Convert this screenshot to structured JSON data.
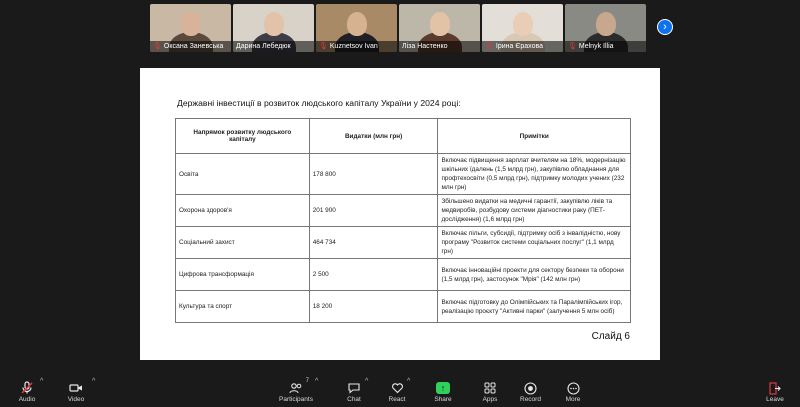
{
  "participants": [
    {
      "name": "Оксана Заневська",
      "muted": true,
      "bg": "#c9b9a4",
      "skin": "#d8b39a",
      "shirt": "#5b4a3c"
    },
    {
      "name": "Дарина Лебедюк",
      "muted": false,
      "bg": "#d8d2c8",
      "skin": "#e2c3aa",
      "shirt": "#3e3d45"
    },
    {
      "name": "Kuznetsov Ivan",
      "muted": true,
      "bg": "#a88a66",
      "skin": "#d6b291",
      "shirt": "#1f2026"
    },
    {
      "name": "Ліза Настенко",
      "muted": false,
      "bg": "#bdb7aa",
      "skin": "#e3c3a6",
      "shirt": "#5a3a2a"
    },
    {
      "name": "Ірина Єрахова",
      "muted": true,
      "bg": "#e3dfd8",
      "skin": "#e9cdb6",
      "shirt": "#d9c8b4"
    },
    {
      "name": "Melnyk Illia",
      "muted": true,
      "bg": "#8a8a84",
      "skin": "#c7a88e",
      "shirt": "#2b2b2b"
    }
  ],
  "slide": {
    "title": "Державні інвестиції в розвиток людського капіталу України у 2024 році:",
    "headers": [
      "Напрямок розвитку людського капіталу",
      "Видатки (млн грн)",
      "Примітки"
    ],
    "rows": [
      [
        "Освіта",
        "178 800",
        "Включає підвищення зарплат вчителям на 18%, модернізацію шкільних їдалень (1,5 млрд грн), закупівлю обладнання для профтехосвіти (0,5 млрд грн), підтримку молодих учених (232 млн грн)"
      ],
      [
        "Охорона здоров'я",
        "201 900",
        "Збільшено видатки на медичні гарантії, закупівлю ліків та медвиробів, розбудову системи діагностики раку (ПЕТ-дослідження) (1,6 млрд грн)"
      ],
      [
        "Соціальний захист",
        "464 734",
        "Включає пільги, субсидії, підтримку осіб з інвалідністю, нову програму \"Розвиток системи соціальних послуг\" (1,1 млрд грн)"
      ],
      [
        "Цифрова трансформація",
        "2 500",
        "Включає інноваційні проекти для сектору безпеки та оборони (1,5 млрд грн), застосунок \"Мрія\" (142 млн грн)"
      ],
      [
        "Культура та спорт",
        "18 200",
        "Включає підготовку до Олімпійських та Паралімпійських ігор, реалізацію проєкту \"Активні парки\" (залучення 5 млн осіб)"
      ]
    ],
    "slide_number": "Слайд 6"
  },
  "toolbar": {
    "audio": "Audio",
    "video": "Video",
    "participants": "Participants",
    "participants_count": "7",
    "chat": "Chat",
    "react": "React",
    "share": "Share",
    "apps": "Apps",
    "record": "Record",
    "more": "More",
    "leave": "Leave"
  }
}
